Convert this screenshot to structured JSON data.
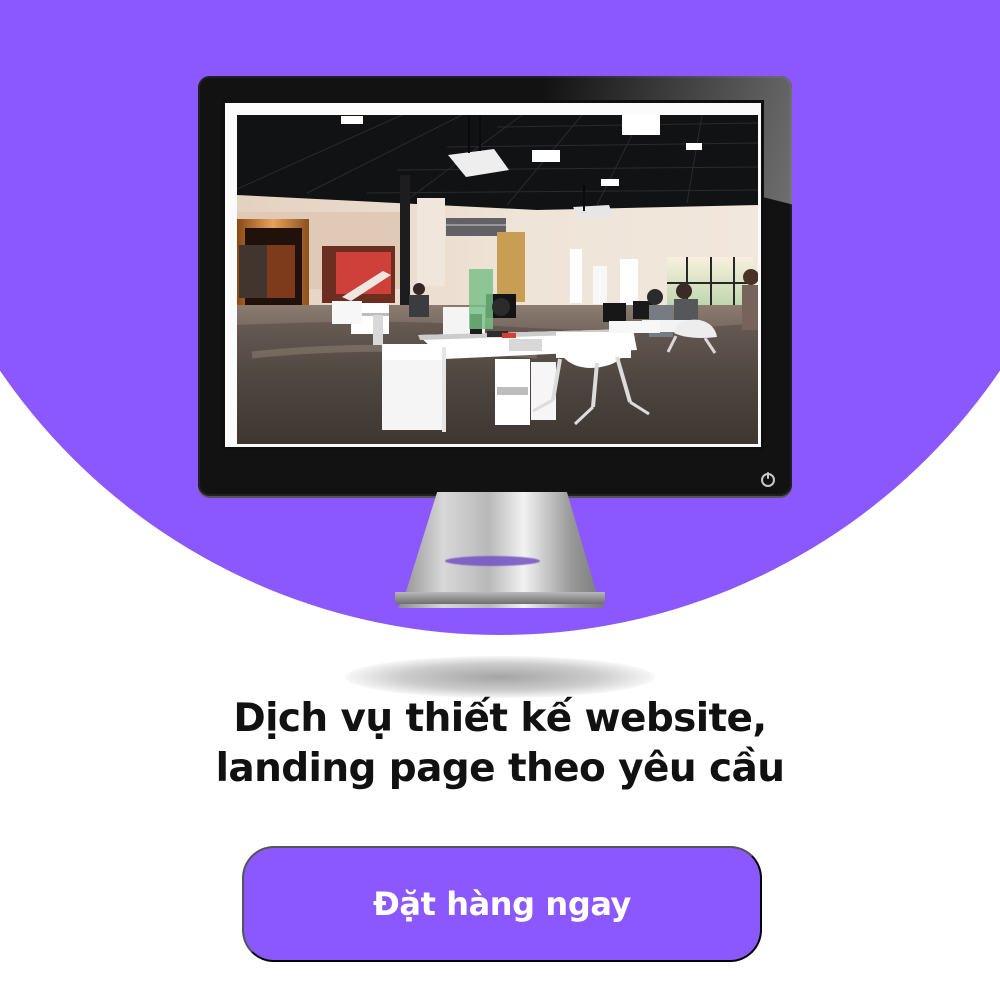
{
  "headline": {
    "line1": "Dịch vụ thiết kế website,",
    "line2": "landing page theo yêu cầu"
  },
  "cta": {
    "label": "Đặt hàng ngay"
  },
  "colors": {
    "accent": "#8b57ff",
    "text": "#111111",
    "background": "#ffffff",
    "monitor": "#121212"
  },
  "icons": {
    "power": "power-icon"
  }
}
